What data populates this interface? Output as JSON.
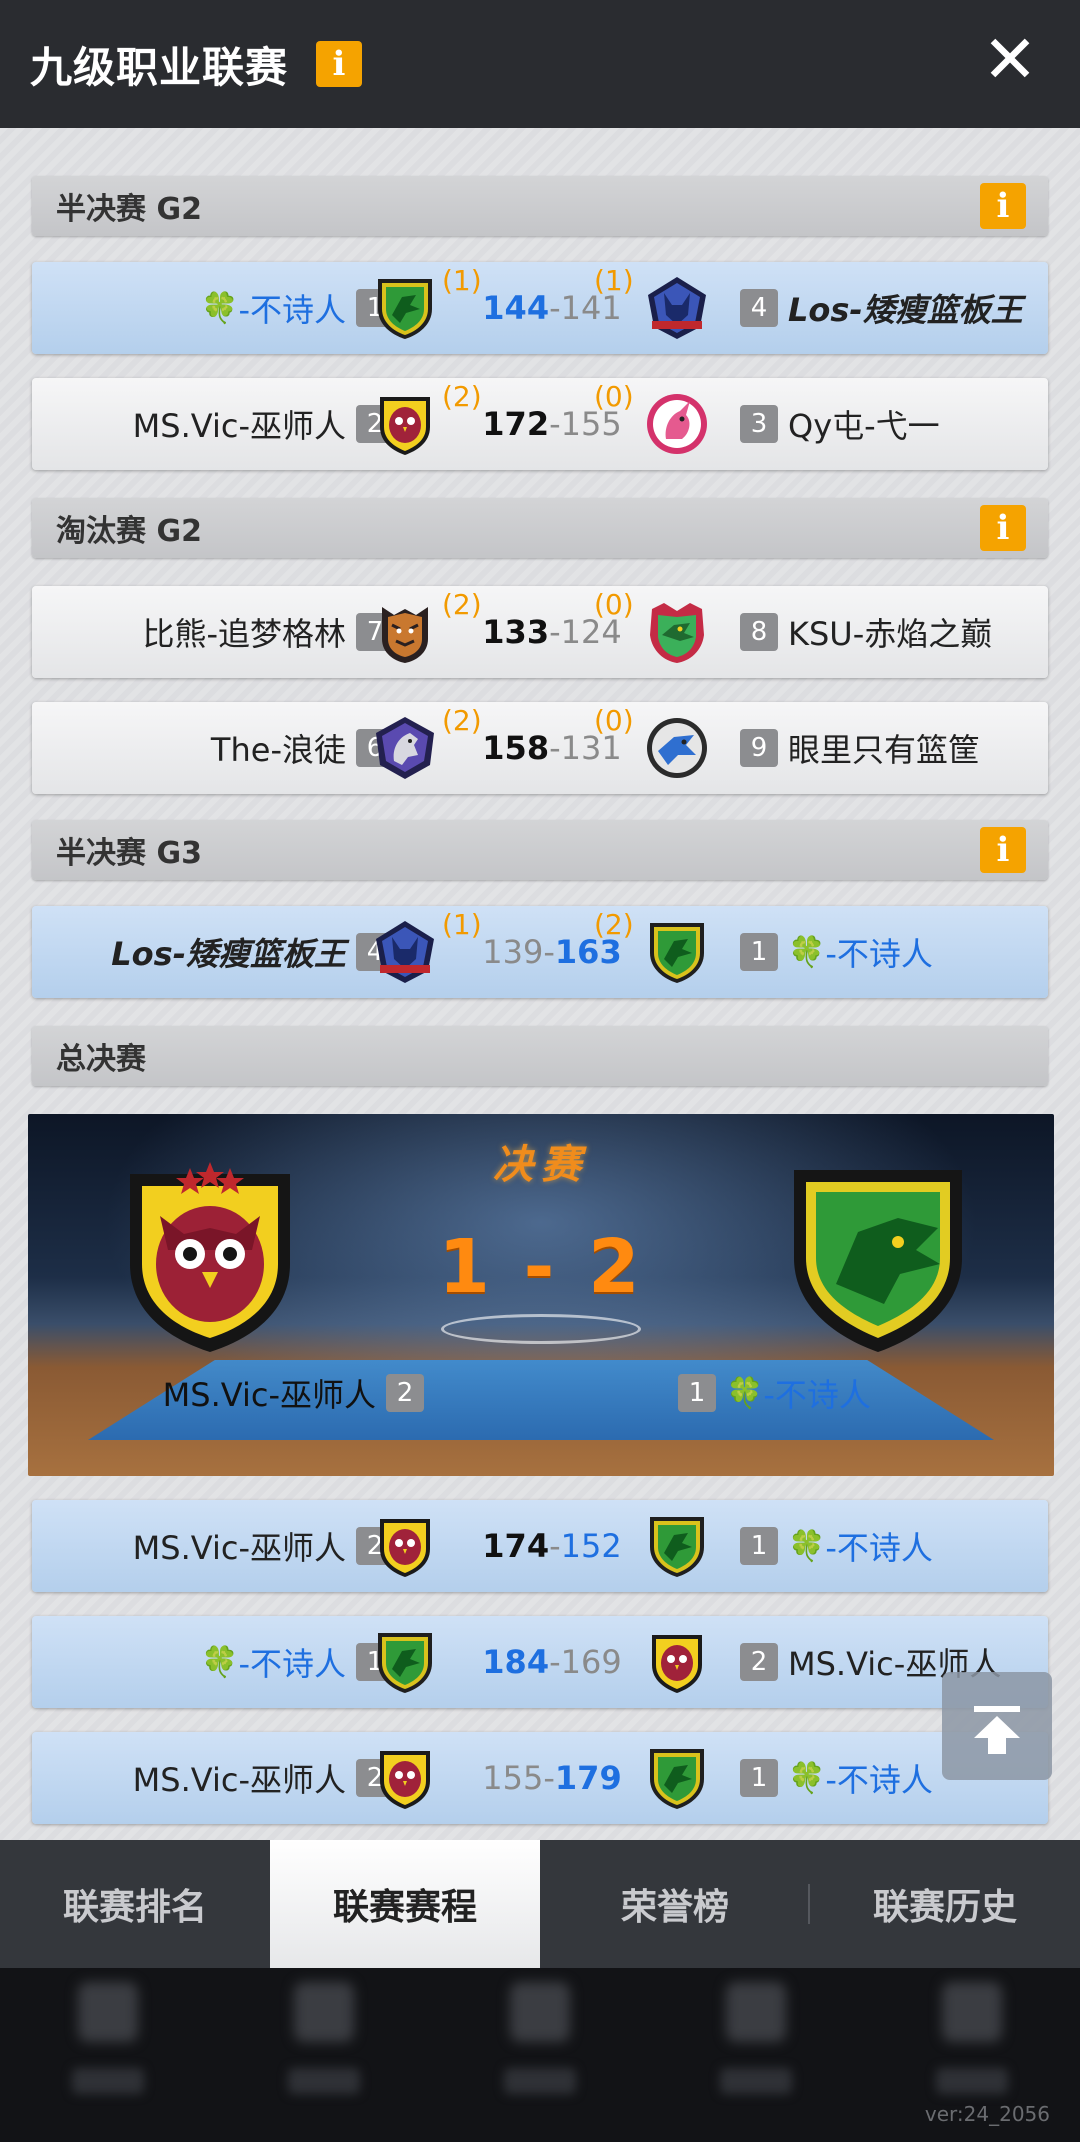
{
  "header": {
    "title": "九级职业联赛",
    "info_icon": "i",
    "close_icon": "✕"
  },
  "sections": {
    "semi_g2": "半决赛 G2",
    "elim_g2": "淘汰赛 G2",
    "semi_g3": "半决赛 G3",
    "final": "总决赛"
  },
  "info_glyph": "i",
  "clover": "🍀",
  "matches": [
    {
      "left_team": "-不诗人",
      "left_rank": "1",
      "left_wins": "(1)",
      "score_left": "144",
      "score_sep": "-",
      "score_right": "141",
      "right_wins": "(1)",
      "right_rank": "4",
      "right_team": "Los-矮瘦篮板王"
    },
    {
      "left_team": "MS.Vic-巫师人",
      "left_rank": "2",
      "left_wins": "(2)",
      "score_left": "172",
      "score_sep": "-",
      "score_right": "155",
      "right_wins": "(0)",
      "right_rank": "3",
      "right_team": "Qy屯-弋一"
    },
    {
      "left_team": "比熊-追梦格林",
      "left_rank": "7",
      "left_wins": "(2)",
      "score_left": "133",
      "score_sep": "-",
      "score_right": "124",
      "right_wins": "(0)",
      "right_rank": "8",
      "right_team": "KSU-赤焰之巅"
    },
    {
      "left_team": "The-浪徒",
      "left_rank": "6",
      "left_wins": "(2)",
      "score_left": "158",
      "score_sep": "-",
      "score_right": "131",
      "right_wins": "(0)",
      "right_rank": "9",
      "right_team": "眼里只有篮筐"
    },
    {
      "left_team": "Los-矮瘦篮板王",
      "left_rank": "4",
      "left_wins": "(1)",
      "score_left": "139",
      "score_sep": "-",
      "score_right": "163",
      "right_wins": "(2)",
      "right_rank": "1",
      "right_team": "-不诗人"
    }
  ],
  "final": {
    "title": "决赛",
    "score": "1 - 2",
    "left_team": "MS.Vic-巫师人",
    "left_rank": "2",
    "right_rank": "1",
    "right_team": "-不诗人"
  },
  "final_games": [
    {
      "left_team": "MS.Vic-巫师人",
      "left_rank": "2",
      "score_left": "174",
      "score_sep": "-",
      "score_right": "152",
      "right_rank": "1",
      "right_team": "-不诗人"
    },
    {
      "left_team": "-不诗人",
      "left_rank": "1",
      "score_left": "184",
      "score_sep": "-",
      "score_right": "169",
      "right_rank": "2",
      "right_team": "MS.Vic-巫师人"
    },
    {
      "left_team": "MS.Vic-巫师人",
      "left_rank": "2",
      "score_left": "155",
      "score_sep": "-",
      "score_right": "179",
      "right_rank": "1",
      "right_team": "-不诗人"
    }
  ],
  "tabs": [
    "联赛排名",
    "联赛赛程",
    "荣誉榜",
    "联赛历史"
  ],
  "active_tab": "联赛赛程",
  "version": "ver:24_2056",
  "colors": {
    "accent_orange": "#f5a300",
    "winner_blue": "#1e6fe0",
    "header_bg": "#2a2c30",
    "highlight_row": "#c4daf2"
  },
  "icons": {
    "header_info": "info-icon",
    "close": "close-icon",
    "back_to_top": "back-to-top-icon",
    "clover": "clover-icon",
    "owl_logo": "owl-logo-icon",
    "dragon_logo": "dragon-logo-icon",
    "wolf_logo": "wolf-logo-icon",
    "unicorn_logo": "unicorn-logo-icon",
    "tiger_logo": "tiger-logo-icon",
    "green_dragon_logo": "dragon-head-logo-icon",
    "horse_logo": "horse-logo-icon",
    "eagle_logo": "eagle-logo-icon"
  }
}
